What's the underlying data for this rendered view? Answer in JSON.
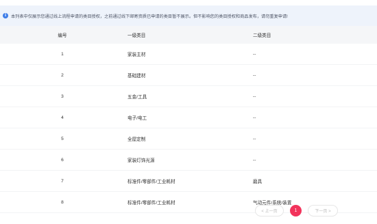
{
  "notice": {
    "icon": "info-icon",
    "text": "本列表中仅展示您通过线上流程申请的类目授权，之前通过线下邮寄资质已申请的类目暂不展示。但不影响您的类目授权和商品发布，请勿重复申请!"
  },
  "table": {
    "headers": [
      "编号",
      "一级类目",
      "二级类目"
    ],
    "rows": [
      [
        "1",
        "家装主材",
        "--"
      ],
      [
        "2",
        "基础建材",
        "--"
      ],
      [
        "3",
        "五金/工具",
        "--"
      ],
      [
        "4",
        "电子/电工",
        "--"
      ],
      [
        "5",
        "全屋定制",
        "--"
      ],
      [
        "6",
        "家装灯饰光源",
        "--"
      ],
      [
        "7",
        "标准件/零部件/工业耗材",
        "磨具"
      ],
      [
        "8",
        "标准件/零部件/工业耗材",
        "气动元件/系统/装置"
      ]
    ]
  },
  "pagination": {
    "prev_label": "< 上一页",
    "current_page": "1",
    "next_label": "下一页 >"
  },
  "colors": {
    "notice_bg": "#eef3fb",
    "info_icon": "#3f7ee8",
    "active_page": "#f2335b",
    "header_bg": "#f5f6f8"
  }
}
